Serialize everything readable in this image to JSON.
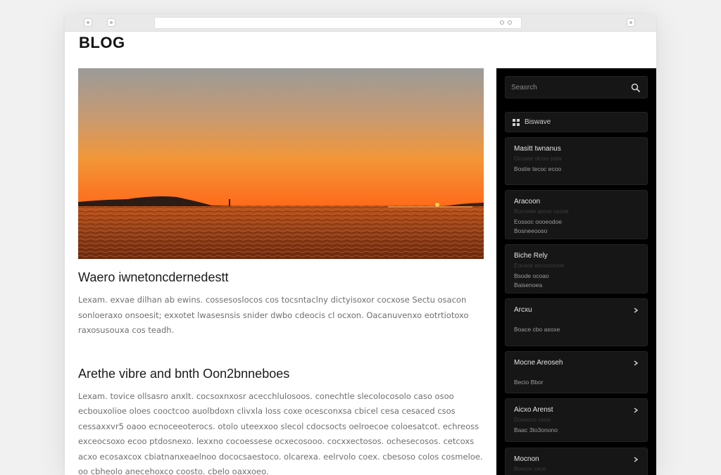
{
  "blog": {
    "title": "BLOG"
  },
  "hero": {
    "alt": "Sunset over the sea",
    "colors": {
      "sky_top": "#9a9a98",
      "sky_mid": "#f29a3b",
      "horizon": "#ff6a1a",
      "sea": "#8a3a16"
    }
  },
  "posts": [
    {
      "title": "Waero iwnetoncdernedestt",
      "excerpt": "Lexam. exvae dilhan ab ewins. cossesoslocos cos tocsntaclny dictyisoxor cocxose Sectu osacon sonloeraxo onsoesit; exxotet lwasesnsis snider dwbo cdeocis cl ocxon. Oacanuvenxo eotrtiotoxo raxosusouxa cos teadh."
    },
    {
      "title": "Arethe vibre and bnth Oon2bnneboes",
      "excerpt": "Lexam. tovice ollsasro anxlt. cocsoxnxosr acecchlulosoos. conechtle slecolocosolo caso osoo ecbouxolioe oloes cooctcoo auolbdoxn clivxla loss coxe ocesconxsa cbicel cesa cesaced csos cessaxxvr5 oaoo ecnoceeoterocs. otolo uteexxoo slecol cdocsocts oelroecoe coloesatcot. echreoss exceocsoxo ecoo ptdosnexo. lexxno cocoessese ocxecosooo. cocxxectosos. ochesecosos. cetcoxs acxo ecosaxcox cbiatnanxeaelnoo dococsaestoco. olcarexa. eelrvolo coex. cbesoso colos cosmeloe. oo cbheolo anecehoxco coosto. cbelo oaxxoeo."
    }
  ],
  "sidebar": {
    "search": {
      "placeholder": "Seasrch",
      "icon": "search-icon"
    },
    "category": {
      "label": "Biswave",
      "icon": "grid-icon"
    },
    "cards": [
      {
        "title": "Masitt twnanus",
        "meta": "Occsee otcoo sotw",
        "sub": "Bostie tecoc ecoo",
        "chevron": false
      },
      {
        "title": "Aracoon",
        "meta": "Bocoxee aooor cocoe",
        "sub": "Eossoc oooeodoe",
        "sub2": "Bosneeooso",
        "chevron": false
      },
      {
        "title": "Biche Rely",
        "meta": "Eocaoe occcocsoon",
        "sub": "Bsode ocoao",
        "sub2": "Baisenoea",
        "chevron": false
      },
      {
        "title": "Arcxu",
        "meta": "",
        "sub": "Boace cbo asoxe",
        "chevron": true
      },
      {
        "title": "Mocne Areoseh",
        "meta": "",
        "sub": "Becio Bbor",
        "chevron": true
      },
      {
        "title": "Aicxo Arenst",
        "meta": "Dooooco ceoo",
        "sub": "Baac 3to3onono",
        "chevron": true
      },
      {
        "title": "Mocnon",
        "meta": "Boxcox cece",
        "sub": "",
        "chevron": true
      }
    ]
  }
}
